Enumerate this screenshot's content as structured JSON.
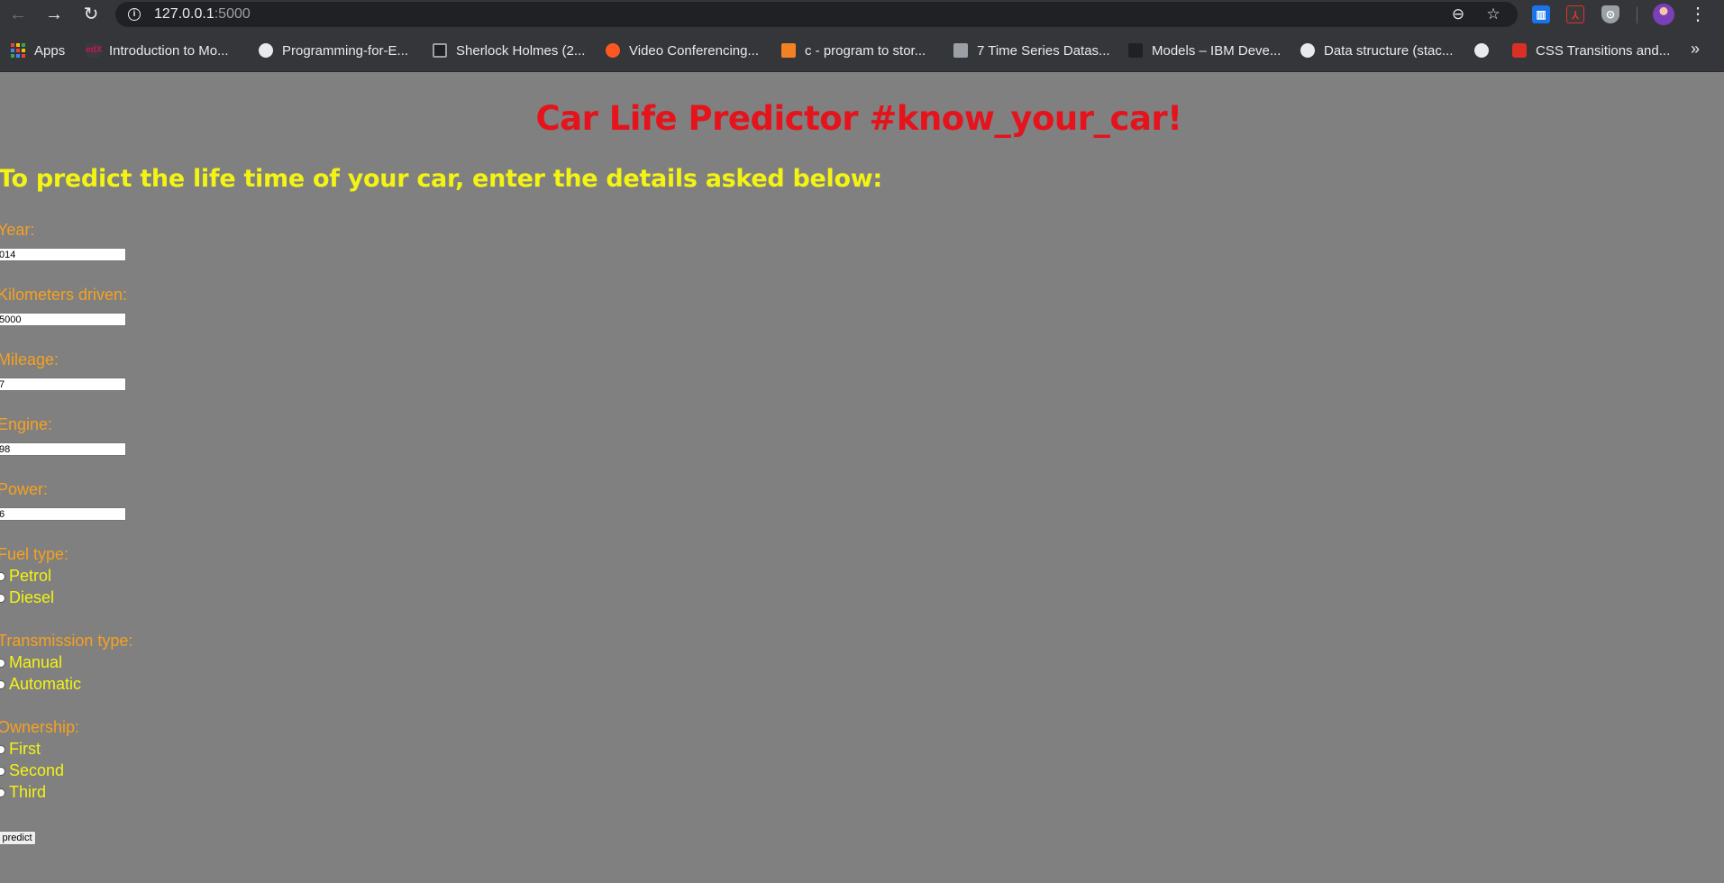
{
  "browser": {
    "url_host": "127.0.0.1",
    "url_port": ":5000",
    "bookmarks_more": "»",
    "bookmarks": [
      {
        "label": "Apps",
        "icon": "apps-grid-icon"
      },
      {
        "label": "Introduction to Mo...",
        "icon": "edx-icon"
      },
      {
        "label": "Programming-for-E...",
        "icon": "github-icon"
      },
      {
        "label": "Sherlock Holmes (2...",
        "icon": "film-icon"
      },
      {
        "label": "Video Conferencing...",
        "icon": "zoho-icon"
      },
      {
        "label": "c - program to stor...",
        "icon": "stackoverflow-icon"
      },
      {
        "label": "7 Time Series Datas...",
        "icon": "dataset-icon"
      },
      {
        "label": "Models – IBM Deve...",
        "icon": "ibm-icon"
      },
      {
        "label": "Data structure (stac...",
        "icon": "globe-icon"
      },
      {
        "label": "",
        "icon": "globe-icon"
      },
      {
        "label": "CSS Transitions and...",
        "icon": "css-icon"
      }
    ]
  },
  "page": {
    "title": "Car Life Predictor #know_your_car!",
    "subtitle": "To predict the life time of your car, enter the details asked below:",
    "fields": [
      {
        "label": "Year:",
        "value": "014"
      },
      {
        "label": "Kilometers driven:",
        "value": "5000"
      },
      {
        "label": "Mileage:",
        "value": "7"
      },
      {
        "label": "Engine:",
        "value": "98"
      },
      {
        "label": "Power:",
        "value": "6"
      }
    ],
    "fuel": {
      "label": "Fuel type:",
      "options": [
        "Petrol",
        "Diesel"
      ]
    },
    "transmission": {
      "label": "Transmission type:",
      "options": [
        "Manual",
        "Automatic"
      ]
    },
    "ownership": {
      "label": "Ownership:",
      "options": [
        "First",
        "Second",
        "Third"
      ]
    },
    "submit_label": "predict"
  }
}
